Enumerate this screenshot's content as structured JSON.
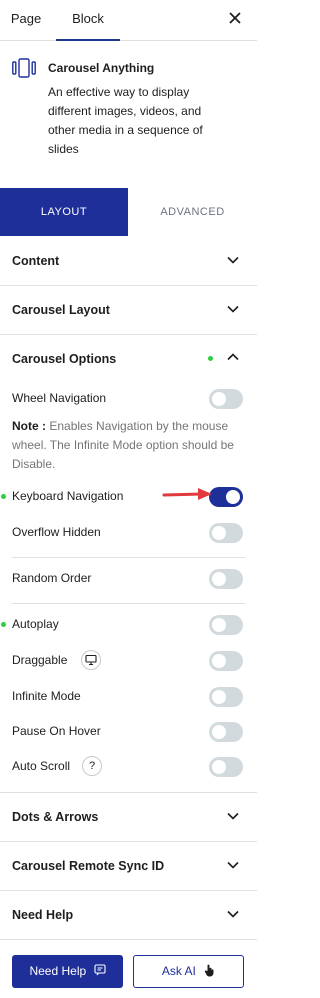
{
  "top_tabs": {
    "page": "Page",
    "block": "Block",
    "close_icon": "close-icon"
  },
  "block": {
    "title": "Carousel Anything",
    "description": "An effective way to display different images, videos, and other media in a sequence of slides"
  },
  "mode_tabs": {
    "layout": "LAYOUT",
    "advanced": "ADVANCED"
  },
  "sections": {
    "content": "Content",
    "carousel_layout": "Carousel Layout",
    "carousel_options": "Carousel Options",
    "dots_arrows": "Dots & Arrows",
    "remote_sync": "Carousel Remote Sync ID",
    "need_help": "Need Help"
  },
  "options": {
    "wheel_navigation": "Wheel Navigation",
    "note_label": "Note :",
    "note_text": "Enables Navigation by the mouse wheel. The Infinite Mode option should be Disable.",
    "keyboard_navigation": "Keyboard Navigation",
    "overflow_hidden": "Overflow Hidden",
    "random_order": "Random Order",
    "autoplay": "Autoplay",
    "draggable": "Draggable",
    "infinite_mode": "Infinite Mode",
    "pause_on_hover": "Pause On Hover",
    "auto_scroll": "Auto Scroll",
    "auto_scroll_help": "?"
  },
  "toggles": {
    "wheel_navigation": false,
    "keyboard_navigation": true,
    "overflow_hidden": false,
    "random_order": false,
    "autoplay": false,
    "draggable": false,
    "infinite_mode": false,
    "pause_on_hover": false,
    "auto_scroll": false
  },
  "buttons": {
    "need_help": "Need Help",
    "ask_ai": "Ask AI"
  },
  "colors": {
    "primary": "#1f2f9a",
    "modified_dot": "#2ecc40",
    "arrow": "#e0393e",
    "toggle_off": "#d3dade"
  }
}
